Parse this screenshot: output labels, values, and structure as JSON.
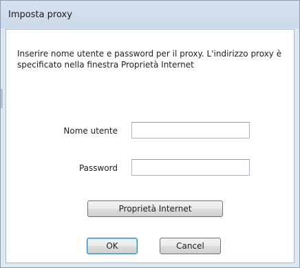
{
  "window": {
    "title": "Imposta proxy"
  },
  "dialog": {
    "description": "Inserire nome utente e password per il proxy. L'indirizzo proxy è specificato nella finestra Proprietà Internet",
    "username": {
      "label": "Nome utente",
      "value": "",
      "placeholder": ""
    },
    "password": {
      "label": "Password",
      "value": "",
      "placeholder": ""
    },
    "buttons": {
      "internet_properties": "Proprietà Internet",
      "ok": "OK",
      "cancel": "Cancel"
    }
  }
}
